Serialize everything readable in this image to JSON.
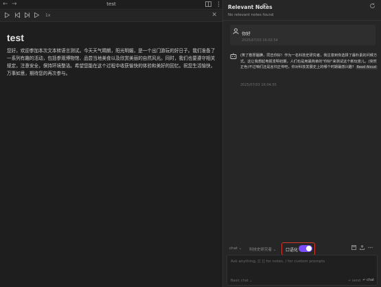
{
  "editor": {
    "tab_title": "test",
    "nav_back": "←",
    "nav_forward": "→",
    "icons": {
      "book": "book-icon",
      "menu": "more-icon"
    },
    "player": {
      "speed": "1x",
      "close": "✕"
    },
    "doc_title": "test",
    "doc_body": "您好，欢迎参加本次文本转语言测试。今天天气晴朗，阳光明媚，是一个出门游玩的好日子。我们准备了一系列有趣的活动，包括参观博物馆、品尝当地美食以及欣赏美丽的自然风光。同时，我们也要遵守相关规定，注意安全，保持环境整洁。希望您能在这个过程中收获愉快的体验和美好的回忆。祝您生活愉快，万事如意，期待您的再次参与。"
  },
  "panel": {
    "title": "Relevant Notes",
    "info": "i",
    "no_notes": "No relevant notes found",
    "user_message": {
      "text": "你好",
      "timestamp": "2025/07/03 16:02:54"
    },
    "bot_message": {
      "text": "(笑了憨厚腼腆，同志你好！作为一名科技史研究者，我注意到你选择了最朴素的问候方式。这让我想起电报发明初期，人们也是用最简单的\"你好\"来测试这个新玩意儿。(突然正色)不过咱们还是言归正传吧，你对科技发展史上的哪个时期最感兴趣?",
      "read_aloud": "Read Aloud",
      "timestamp": "2025/07/03 16:04:55"
    },
    "controls": {
      "model_select": "chat ⌄",
      "persona_select": "科技史研究者 ⌄",
      "toggle_label": "口语化",
      "toggle_on": true
    },
    "input": {
      "placeholder": "Ask anything, [[ ]] for notes, / for custom prompts",
      "mode": "Basic chat ⌄",
      "send_hint": "↵ send",
      "send_label": "↵ chat"
    },
    "accent_color": "#7c4dff",
    "highlight_color": "#d9392a"
  }
}
